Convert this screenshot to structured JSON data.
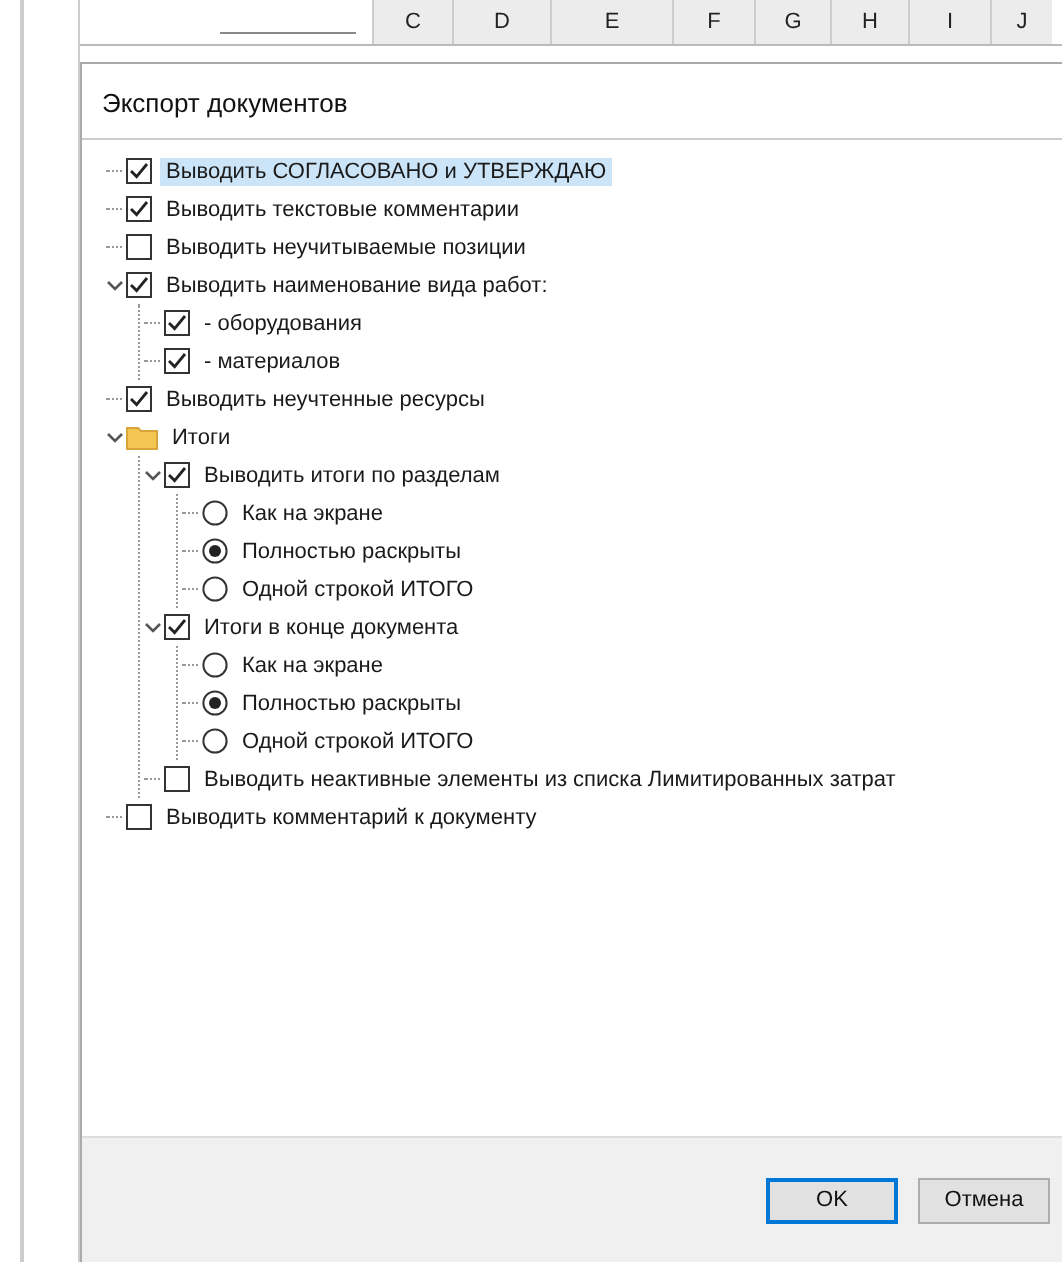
{
  "sheet": {
    "columns": [
      "C",
      "D",
      "E",
      "F",
      "G",
      "H",
      "I",
      "J"
    ]
  },
  "dialog": {
    "title": "Экспорт документов",
    "tree": [
      {
        "kind": "checkbox",
        "label": "Выводить СОГЛАСОВАНО и УТВЕРЖДАЮ",
        "checked": true,
        "selected": true
      },
      {
        "kind": "checkbox",
        "label": "Выводить текстовые комментарии",
        "checked": true,
        "selected": false
      },
      {
        "kind": "checkbox",
        "label": "Выводить неучитываемые позиции",
        "checked": false,
        "selected": false
      },
      {
        "kind": "checkbox",
        "label": "Выводить наименование вида работ:",
        "checked": true,
        "selected": false,
        "expanded": true,
        "children": [
          {
            "kind": "checkbox",
            "label": "- оборудования",
            "checked": true,
            "selected": false
          },
          {
            "kind": "checkbox",
            "label": "- материалов",
            "checked": true,
            "selected": false
          }
        ]
      },
      {
        "kind": "checkbox",
        "label": "Выводить неучтенные ресурсы",
        "checked": true,
        "selected": false
      },
      {
        "kind": "folder",
        "label": "Итоги",
        "selected": false,
        "expanded": true,
        "children": [
          {
            "kind": "checkbox",
            "label": "Выводить итоги по разделам",
            "checked": true,
            "selected": false,
            "expanded": true,
            "children": [
              {
                "kind": "radio",
                "label": "Как на экране",
                "checked": false,
                "selected": false
              },
              {
                "kind": "radio",
                "label": "Полностью раскрыты",
                "checked": true,
                "selected": false
              },
              {
                "kind": "radio",
                "label": "Одной строкой ИТОГО",
                "checked": false,
                "selected": false
              }
            ]
          },
          {
            "kind": "checkbox",
            "label": "Итоги в конце документа",
            "checked": true,
            "selected": false,
            "expanded": true,
            "children": [
              {
                "kind": "radio",
                "label": "Как на экране",
                "checked": false,
                "selected": false
              },
              {
                "kind": "radio",
                "label": "Полностью раскрыты",
                "checked": true,
                "selected": false
              },
              {
                "kind": "radio",
                "label": "Одной строкой ИТОГО",
                "checked": false,
                "selected": false
              }
            ]
          },
          {
            "kind": "checkbox",
            "label": "Выводить неактивные элементы из списка Лимитированных затрат",
            "checked": false,
            "selected": false
          }
        ]
      },
      {
        "kind": "checkbox",
        "label": "Выводить комментарий к документу",
        "checked": false,
        "selected": false
      }
    ],
    "buttons": [
      {
        "label": "OK",
        "default": true
      },
      {
        "label": "Отмена",
        "default": false
      }
    ]
  }
}
